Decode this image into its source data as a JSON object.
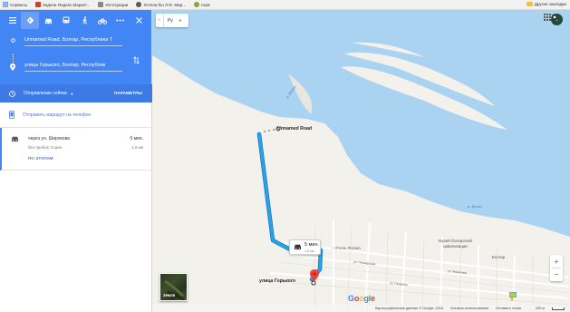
{
  "bookmarks_bar": {
    "items": [
      {
        "label": "Сервисы",
        "icon": "apps-grid-icon",
        "color": "#4285f4"
      },
      {
        "label": "Задачи Яндекс.Маркет...",
        "icon": "bookmark-page-icon",
        "color": "#d23d2a"
      },
      {
        "label": "Интеграции",
        "icon": "bookmark-page-icon",
        "color": "#888888"
      },
      {
        "label": "Хотели бы Л.Ф. Мир...",
        "icon": "bookmark-globe-icon",
        "color": "#5a5a5a"
      },
      {
        "label": "mais",
        "icon": "bookmark-site-icon",
        "color": "#8fa13b"
      }
    ],
    "other_bookmarks": "Другие закладки"
  },
  "directions": {
    "from": "Unnamed Road, Болгар, Республика Т",
    "to": "улица Горького, Болгар, Республик",
    "depart_label": "Отправление сейчас",
    "options_label": "ПАРАМЕТРЫ",
    "send_label": "Отправить маршрут на телефон",
    "routes": [
      {
        "via": "через ул. Широкова",
        "time": "5 мин.",
        "traffic": "без пробок: 5 мин.",
        "distance": "1,9 км",
        "steps_label": "ПО ЭТАПАМ"
      }
    ]
  },
  "map": {
    "language": "Ру",
    "avatar_letter": "t",
    "start_label": "Unnamed Road",
    "end_label": "улица Горького",
    "tooltip_time": "5 мин.",
    "tooltip_distance": "1,9 км",
    "street_label": "Отель Регина",
    "museum_line1": "Музей болгарской",
    "museum_line2": "цивилизации",
    "town_label": "Болгар",
    "water_labels": [
      "р. Волга",
      "р. Волга"
    ],
    "street_names": [
      "ул. Пионерская",
      "ул. Мазитова",
      "ул. Гагарина"
    ],
    "earth_label": "Земля",
    "footer": {
      "data": "Картографические данные © Google, 2018",
      "terms": "Условия использования",
      "feedback": "Оставить отзыв",
      "scale": "200 м"
    }
  },
  "colors": {
    "header_blue": "#4285f4",
    "route_blue": "#29a3e8",
    "water": "#aad3f1",
    "land": "#f3f1ec"
  }
}
